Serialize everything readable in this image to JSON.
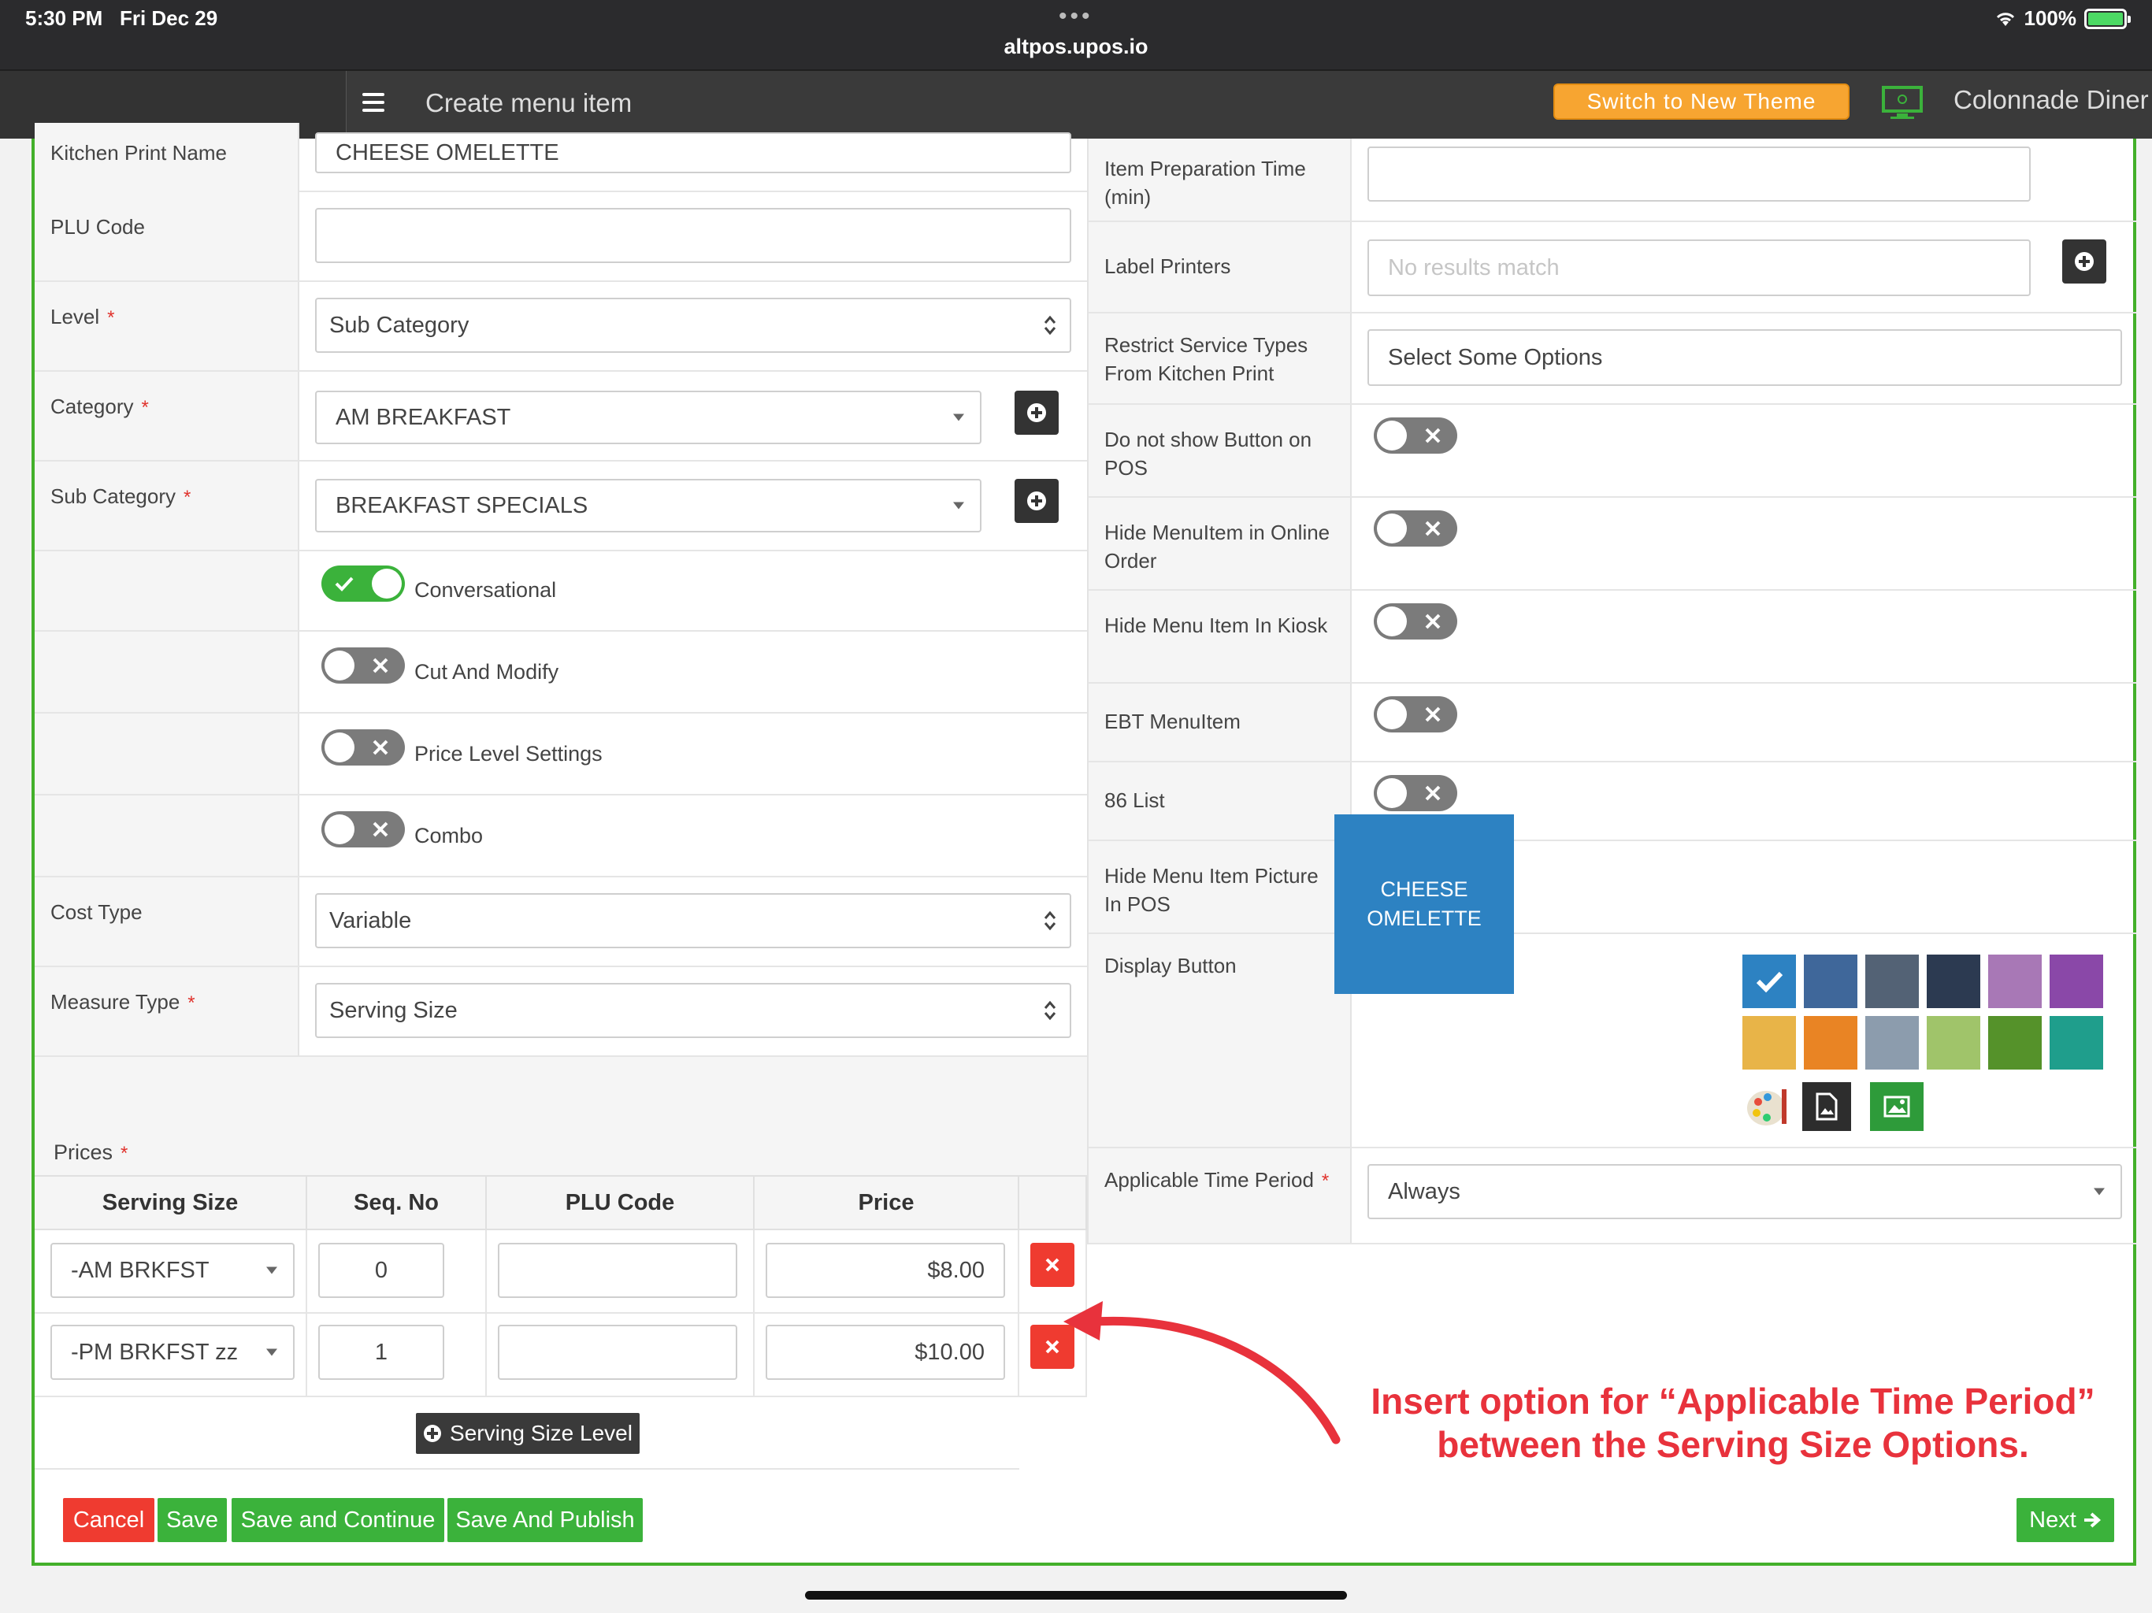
{
  "status_bar": {
    "time": "5:30 PM",
    "date": "Fri Dec 29",
    "url": "altpos.upos.io",
    "battery": "100%"
  },
  "header": {
    "title": "Create menu item",
    "switch_theme": "Switch to New Theme",
    "store_name": "Colonnade Diner"
  },
  "left_form": {
    "kitchen_print_name": {
      "label": "Kitchen Print Name",
      "value": "CHEESE OMELETTE"
    },
    "plu_code": {
      "label": "PLU Code",
      "value": ""
    },
    "level": {
      "label": "Level",
      "value": "Sub Category"
    },
    "category": {
      "label": "Category",
      "value": "AM BREAKFAST"
    },
    "sub_category": {
      "label": "Sub Category",
      "value": "BREAKFAST SPECIALS"
    },
    "toggles": [
      {
        "label": "Conversational",
        "on": true
      },
      {
        "label": "Cut And Modify",
        "on": false
      },
      {
        "label": "Price Level Settings",
        "on": false
      },
      {
        "label": "Combo",
        "on": false
      }
    ],
    "cost_type": {
      "label": "Cost Type",
      "value": "Variable"
    },
    "measure_type": {
      "label": "Measure Type",
      "value": "Serving Size"
    }
  },
  "required_mark": "*",
  "prices": {
    "label": "Prices",
    "columns": [
      "Serving Size",
      "Seq. No",
      "PLU Code",
      "Price"
    ],
    "rows": [
      {
        "serving_size": "-AM BRKFST",
        "seq": "0",
        "plu": "",
        "price": "$8.00"
      },
      {
        "serving_size": "-PM BRKFST zz",
        "seq": "1",
        "plu": "",
        "price": "$10.00"
      }
    ],
    "add_button": "Serving Size Level"
  },
  "right_form": {
    "prep_time": {
      "label": "Item Preparation Time (min)",
      "value": ""
    },
    "label_printers": {
      "label": "Label Printers",
      "placeholder": "No results match"
    },
    "restrict_service": {
      "label": "Restrict Service Types From Kitchen Print",
      "placeholder": "Select Some Options"
    },
    "toggles": [
      {
        "label": "Do not show Button on POS",
        "on": false
      },
      {
        "label": "Hide MenuItem in Online Order",
        "on": false
      },
      {
        "label": "Hide Menu Item In Kiosk",
        "on": false
      },
      {
        "label": "EBT MenuItem",
        "on": false
      },
      {
        "label": "86 List",
        "on": false
      },
      {
        "label": "Hide Menu Item Picture In POS",
        "on": false
      }
    ],
    "display_button": {
      "label": "Display Button",
      "preview_line1": "CHEESE",
      "preview_line2": "OMELETTE"
    },
    "swatches": [
      "#2d82c2",
      "#3f679a",
      "#536275",
      "#2c3a51",
      "#a878b6",
      "#8a48a8",
      "#e8b448",
      "#e98424",
      "#8c9cad",
      "#a0c46a",
      "#55922a",
      "#1f9e8c"
    ],
    "applicable_time_period": {
      "label": "Applicable Time Period",
      "value": "Always"
    }
  },
  "footer": {
    "cancel": "Cancel",
    "save": "Save",
    "save_continue": "Save and Continue",
    "save_publish": "Save And Publish",
    "next": "Next"
  },
  "annotation": {
    "line1": "Insert option for “Applicable Time Period”",
    "line2": "between the Serving Size Options.",
    "color": "#e8323c"
  },
  "colors": {
    "accent_green": "#3bb23b",
    "danger_red": "#ef3b30",
    "theme_orange": "#f7a531",
    "header_dark": "#3a3a3a"
  }
}
